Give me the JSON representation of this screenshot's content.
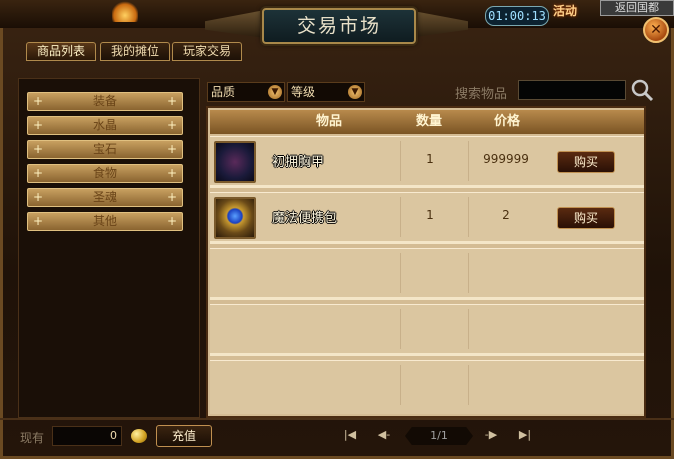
{
  "window": {
    "title": "交易市场",
    "clock": "01:00:13",
    "activity_label": "活动",
    "return_label": "返回国都"
  },
  "tabs": [
    {
      "label": "商品列表",
      "active": true
    },
    {
      "label": "我的摊位",
      "active": false
    },
    {
      "label": "玩家交易",
      "active": false
    }
  ],
  "categories": [
    "装备",
    "水晶",
    "宝石",
    "食物",
    "圣魂",
    "其他"
  ],
  "filters": {
    "quality_label": "品质",
    "level_label": "等级",
    "search_label": "搜索物品",
    "search_value": ""
  },
  "table": {
    "headers": {
      "item": "物品",
      "qty": "数量",
      "price": "价格"
    },
    "rows": [
      {
        "icon": "armor-icon",
        "name": "初拥胸甲",
        "qty": "1",
        "price": "999999",
        "buy_label": "购买"
      },
      {
        "icon": "bag-icon",
        "name": "魔法便携包",
        "qty": "1",
        "price": "2",
        "buy_label": "购买"
      }
    ]
  },
  "footer": {
    "currency_label": "现有",
    "amount": "0",
    "recharge_label": "充值",
    "page": "1/1"
  },
  "colors": {
    "accent": "#c09050",
    "panel": "#d4bc94"
  }
}
